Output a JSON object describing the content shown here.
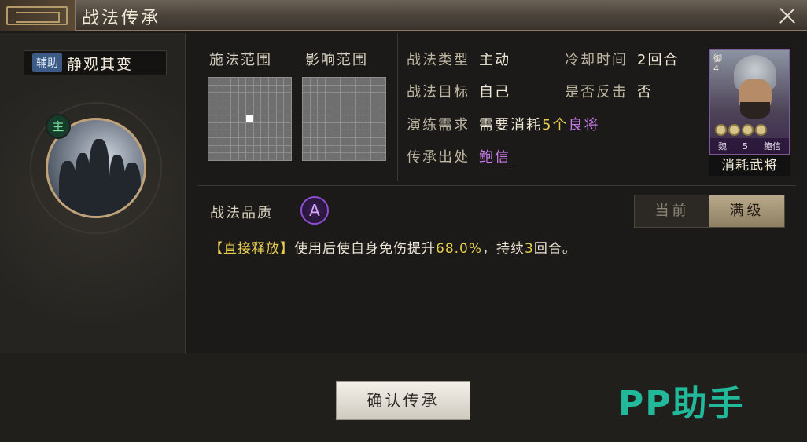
{
  "window": {
    "title": "战法传承"
  },
  "skill": {
    "tag": "辅助",
    "name": "静观其变",
    "role_badge": "主"
  },
  "ranges": {
    "cast_label": "施法范围",
    "effect_label": "影响范围"
  },
  "info": {
    "type_key": "战法类型",
    "type_val": "主动",
    "cooldown_key": "冷却时间",
    "cooldown_val": "2回合",
    "target_key": "战法目标",
    "target_val": "自己",
    "counter_key": "是否反击",
    "counter_val": "否",
    "training_key": "演练需求",
    "training_prefix": "需要消耗",
    "training_count": "5个",
    "training_grade": "良将",
    "source_key": "传承出处",
    "source_val": "鲍信"
  },
  "card": {
    "side": "御",
    "level": "4",
    "faction": "魏",
    "cost": "5",
    "name": "鲍信",
    "caption": "消耗武将",
    "stars": 4
  },
  "quality": {
    "label": "战法品质",
    "grade": "A"
  },
  "toggle": {
    "current": "当前",
    "max": "满级"
  },
  "description": {
    "tag": "【直接释放】",
    "text1": "使用后使自身免伤提升",
    "value": "68.0%",
    "text2": "，持续",
    "rounds": "3",
    "text3": "回合。"
  },
  "actions": {
    "confirm": "确认传承"
  },
  "watermark": "PP助手",
  "colors": {
    "accent_yellow": "#e7cf4f",
    "accent_purple": "#c47ae6",
    "watermark": "#22b89a"
  }
}
